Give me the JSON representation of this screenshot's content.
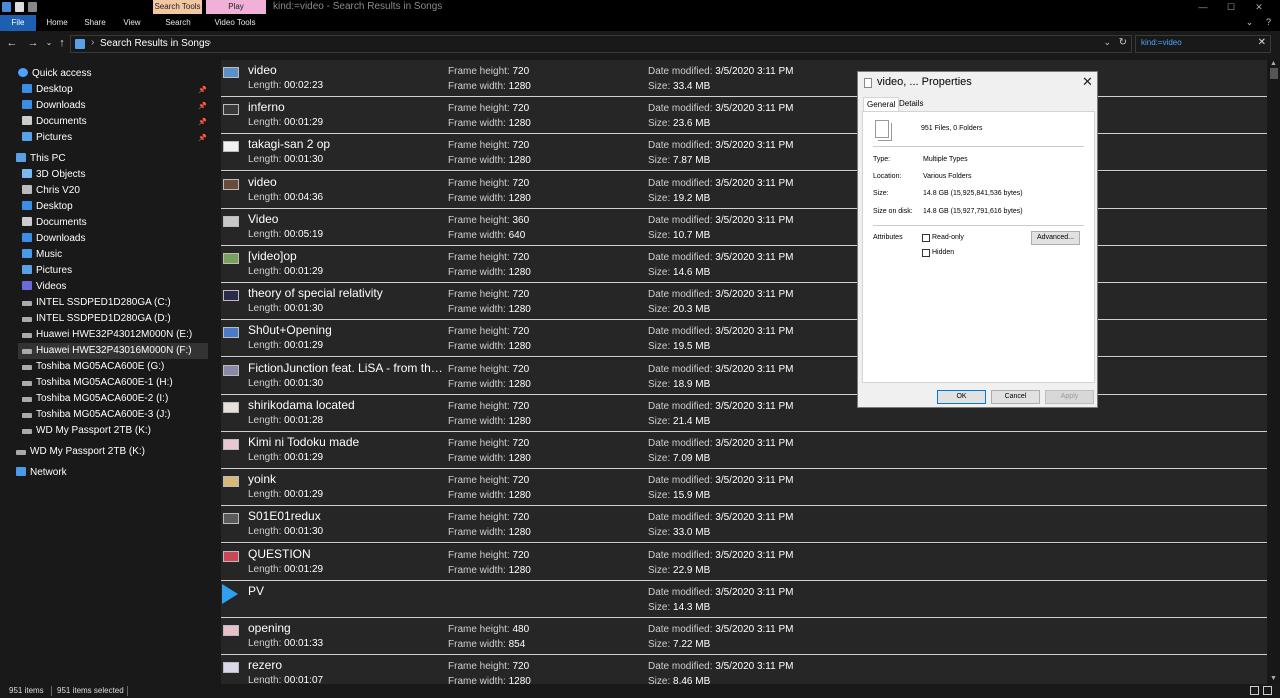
{
  "window": {
    "title": "kind:=video - Search Results in Songs",
    "contextual_tabs": {
      "search_tools": "Search Tools",
      "play": "Play"
    },
    "controls": {
      "minimize": "—",
      "maximize": "☐",
      "close": "✕"
    }
  },
  "ribbon": {
    "tabs": [
      "File",
      "Home",
      "Share",
      "View",
      "Search",
      "Video Tools"
    ]
  },
  "address": {
    "breadcrumb": "Search Results in Songs",
    "search_value": "kind:=video"
  },
  "nav": {
    "quick_access": "Quick access",
    "quick_items": [
      "Desktop",
      "Downloads",
      "Documents",
      "Pictures"
    ],
    "this_pc": "This PC",
    "pc_items": [
      "3D Objects",
      "Chris V20",
      "Desktop",
      "Documents",
      "Downloads",
      "Music",
      "Pictures",
      "Videos"
    ],
    "drives": [
      "INTEL SSDPED1D280GA (C:)",
      "INTEL SSDPED1D280GA (D:)",
      "Huawei HWE32P43012M000N (E:)",
      "Huawei HWE32P43016M000N (F:)",
      "Toshiba MG05ACA600E (G:)",
      "Toshiba MG05ACA600E-1 (H:)",
      "Toshiba MG05ACA600E-2 (I:)",
      "Toshiba MG05ACA600E-3 (J:)",
      "WD My Passport 2TB (K:)"
    ],
    "passport": "WD My Passport 2TB (K:)",
    "network": "Network"
  },
  "labels": {
    "length": "Length:",
    "frame_height": "Frame height:",
    "frame_width": "Frame width:",
    "date_modified": "Date modified:",
    "size": "Size:"
  },
  "files": [
    {
      "name": "video",
      "length": "00:02:23",
      "height": "720",
      "width": "1280",
      "date": "3/5/2020 3:11 PM",
      "size": "33.4 MB",
      "thumb": "#5a8fc8"
    },
    {
      "name": "inferno",
      "length": "00:01:29",
      "height": "720",
      "width": "1280",
      "date": "3/5/2020 3:11 PM",
      "size": "23.6 MB",
      "thumb": "#3a3a3a"
    },
    {
      "name": "takagi-san 2 op",
      "length": "00:01:30",
      "height": "720",
      "width": "1280",
      "date": "3/5/2020 3:11 PM",
      "size": "7.87 MB",
      "thumb": "#f2f2f2"
    },
    {
      "name": "video",
      "length": "00:04:36",
      "height": "720",
      "width": "1280",
      "date": "3/5/2020 3:11 PM",
      "size": "19.2 MB",
      "thumb": "#6a4a3a"
    },
    {
      "name": "Video",
      "length": "00:05:19",
      "height": "360",
      "width": "640",
      "date": "3/5/2020 3:11 PM",
      "size": "10.7 MB",
      "thumb": "#c8c8c8"
    },
    {
      "name": "[video]op",
      "length": "00:01:29",
      "height": "720",
      "width": "1280",
      "date": "3/5/2020 3:11 PM",
      "size": "14.6 MB",
      "thumb": "#7aa060"
    },
    {
      "name": "theory of special relativity",
      "length": "00:01:30",
      "height": "720",
      "width": "1280",
      "date": "3/5/2020 3:11 PM",
      "size": "20.3 MB",
      "thumb": "#2a2a4a"
    },
    {
      "name": "Sh0ut+Opening",
      "length": "00:01:29",
      "height": "720",
      "width": "1280",
      "date": "3/5/2020 3:11 PM",
      "size": "19.5 MB",
      "thumb": "#4a7ac8"
    },
    {
      "name": "FictionJunction feat. LiSA - from the...",
      "length": "00:01:30",
      "height": "720",
      "width": "1280",
      "date": "3/5/2020 3:11 PM",
      "size": "18.9 MB",
      "thumb": "#8a8aa8"
    },
    {
      "name": "shirikodama located",
      "length": "00:01:28",
      "height": "720",
      "width": "1280",
      "date": "3/5/2020 3:11 PM",
      "size": "21.4 MB",
      "thumb": "#e8e0d8"
    },
    {
      "name": "Kimi ni Todoku made",
      "length": "00:01:29",
      "height": "720",
      "width": "1280",
      "date": "3/5/2020 3:11 PM",
      "size": "7.09 MB",
      "thumb": "#e8c8d0"
    },
    {
      "name": "yoink",
      "length": "00:01:29",
      "height": "720",
      "width": "1280",
      "date": "3/5/2020 3:11 PM",
      "size": "15.9 MB",
      "thumb": "#d8b878"
    },
    {
      "name": "S01E01redux",
      "length": "00:01:30",
      "height": "720",
      "width": "1280",
      "date": "3/5/2020 3:11 PM",
      "size": "33.0 MB",
      "thumb": "#5a5a5a"
    },
    {
      "name": "QUESTION",
      "length": "00:01:29",
      "height": "720",
      "width": "1280",
      "date": "3/5/2020 3:11 PM",
      "size": "22.9 MB",
      "thumb": "#c84858"
    },
    {
      "name": "PV",
      "length": "",
      "height": "",
      "width": "",
      "date": "3/5/2020 3:11 PM",
      "size": "14.3 MB",
      "thumb": "play"
    },
    {
      "name": "opening",
      "length": "00:01:33",
      "height": "480",
      "width": "854",
      "date": "3/5/2020 3:11 PM",
      "size": "7.22 MB",
      "thumb": "#e8c0c8"
    },
    {
      "name": "rezero",
      "length": "00:01:07",
      "height": "720",
      "width": "1280",
      "date": "3/5/2020 3:11 PM",
      "size": "8.46 MB",
      "thumb": "#d8d8e8"
    }
  ],
  "status": {
    "count": "951 items",
    "selected": "951 items selected"
  },
  "dialog": {
    "title": "video, ... Properties",
    "tabs": [
      "General",
      "Details"
    ],
    "summary": "951 Files, 0 Folders",
    "type_label": "Type:",
    "type_value": "Multiple Types",
    "location_label": "Location:",
    "location_value": "Various Folders",
    "size_label": "Size:",
    "size_value": "14.8 GB (15,925,841,536 bytes)",
    "disk_label": "Size on disk:",
    "disk_value": "14.8 GB (15,927,791,616 bytes)",
    "attributes_label": "Attributes",
    "readonly_label": "Read-only",
    "hidden_label": "Hidden",
    "advanced_label": "Advanced...",
    "ok_label": "OK",
    "cancel_label": "Cancel",
    "apply_label": "Apply"
  }
}
